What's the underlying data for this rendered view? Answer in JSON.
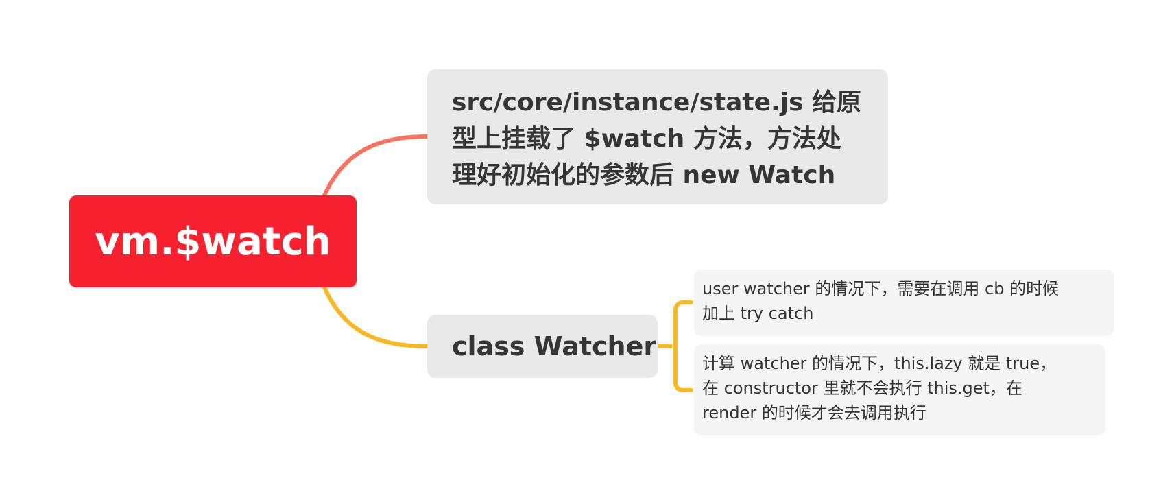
{
  "colors": {
    "root_fill": "#f7202f",
    "branch_1_connector": "#f8735f",
    "branch_2_connector": "#fab71f",
    "branch_fill": "#e9e9e9",
    "leaf_fill": "#f5f5f5"
  },
  "root": {
    "label": "vm.$watch"
  },
  "branches": [
    {
      "lines": [
        "src/core/instance/state.js 给原",
        "型上挂载了 $watch 方法，方法处",
        "理好初始化的参数后 new Watch"
      ]
    },
    {
      "label": "class Watcher",
      "children": [
        {
          "lines": [
            "user watcher 的情况下，需要在调用 cb 的时候",
            "加上 try catch"
          ]
        },
        {
          "lines": [
            "计算 watcher 的情况下，this.lazy 就是 true，",
            "在 constructor 里就不会执行 this.get，在",
            "render 的时候才会去调用执行"
          ]
        }
      ]
    }
  ]
}
